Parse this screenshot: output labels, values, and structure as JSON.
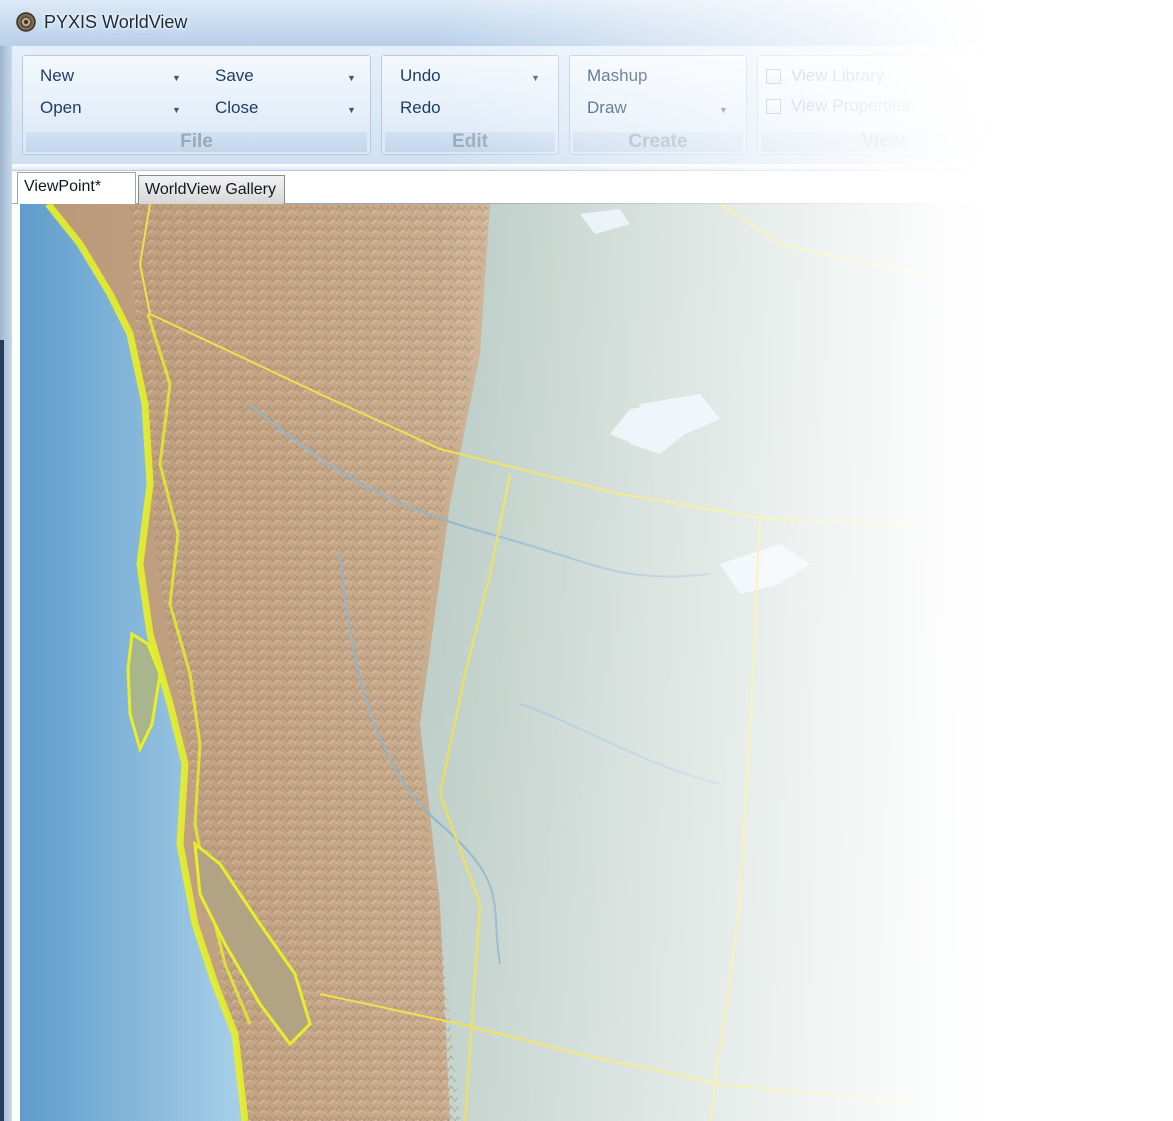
{
  "window": {
    "title": "PYXIS WorldView",
    "icon": "globe-icon"
  },
  "ribbon": {
    "file": {
      "group_label": "File",
      "new_label": "New",
      "open_label": "Open",
      "save_label": "Save",
      "close_label": "Close"
    },
    "edit": {
      "group_label": "Edit",
      "undo_label": "Undo",
      "redo_label": "Redo"
    },
    "create": {
      "group_label": "Create",
      "mashup_label": "Mashup",
      "draw_label": "Draw"
    },
    "view": {
      "group_label": "View",
      "library_label": "View Library",
      "properties_label": "View Properties",
      "library_checked": false,
      "properties_checked": false
    }
  },
  "tabs": [
    {
      "label": "ViewPoint*",
      "active": true
    },
    {
      "label": "WorldView Gallery",
      "active": false
    }
  ],
  "map": {
    "colors": {
      "ocean": "#7fb1d6",
      "land": "#c9ab8c",
      "plains": "#cfd9d1",
      "lake": "#e2eef7",
      "border": "#f2e04a",
      "coast": "#e9f22a"
    }
  }
}
